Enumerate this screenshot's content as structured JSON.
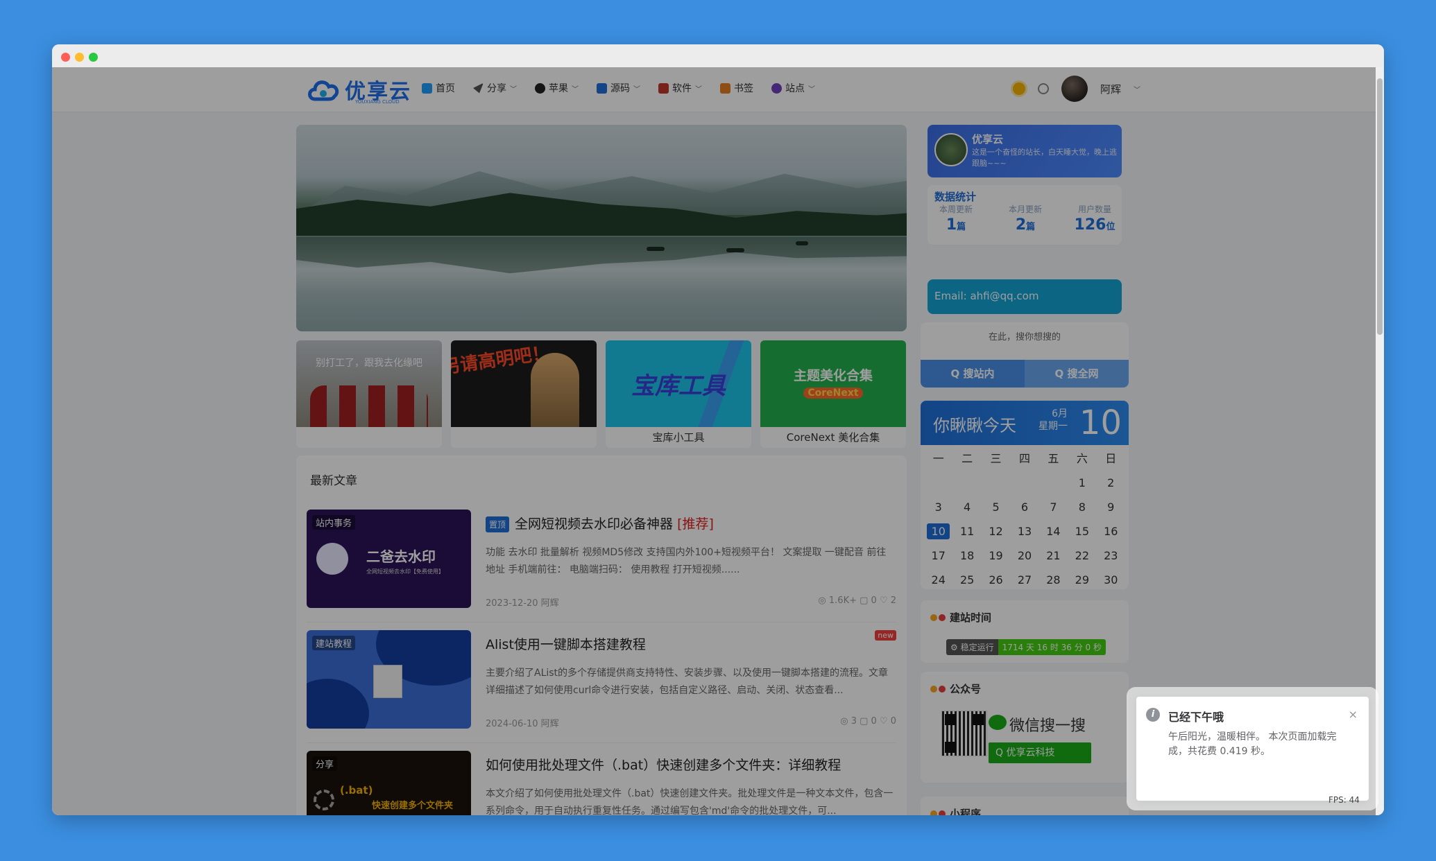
{
  "header": {
    "logo_text": "优享云",
    "logo_sub": "YOUXIANG CLOUD",
    "nav": [
      {
        "label": "首页",
        "color": "#1e9fff",
        "has_chevron": false
      },
      {
        "label": "分享",
        "color": "#555",
        "has_chevron": true
      },
      {
        "label": "苹果",
        "color": "#222",
        "has_chevron": true
      },
      {
        "label": "源码",
        "color": "#1e6fd9",
        "has_chevron": true
      },
      {
        "label": "软件",
        "color": "#c0392b",
        "has_chevron": true
      },
      {
        "label": "书签",
        "color": "#e67e22",
        "has_chevron": false
      },
      {
        "label": "站点",
        "color": "#6f42c1",
        "has_chevron": true
      }
    ],
    "user": "阿辉"
  },
  "promos": [
    {
      "img_text": "别打工了，跟我去化缘吧",
      "caption": ""
    },
    {
      "img_text": "另请高明吧！",
      "caption": ""
    },
    {
      "img_text": "宝库工具",
      "caption": "宝库小工具"
    },
    {
      "img_text": "主题美化合集",
      "img_sub": "CoreNext",
      "caption": "CoreNext 美化合集"
    }
  ],
  "articles": {
    "section_title": "最新文章",
    "items": [
      {
        "tag": "站内事务",
        "thumb_text": "二爸去水印",
        "thumb_sub": "全网短视频去水印【免费使用】",
        "pin": "置顶",
        "title": "全网短视频去水印必备神器",
        "rec": "[推荐]",
        "desc": "功能 去水印 批量解析 视频MD5修改 支持国内外100+短视频平台！ 文案提取 一键配音 前往地址 手机端前往：  电脑端扫码：  使用教程 打开短视频......",
        "meta": "2023-12-20 阿辉",
        "stats": "◎ 1.6K+ ▢ 0 ♡ 2"
      },
      {
        "tag": "建站教程",
        "new": "new",
        "title": "Alist使用一键脚本搭建教程",
        "desc": "主要介绍了AList的多个存储提供商支持特性、安装步骤、以及使用一键脚本搭建的流程。文章详细描述了如何使用curl命令进行安装，包括自定义路径、启动、关闭、状态查看...",
        "meta": "2024-06-10 阿辉",
        "stats": "◎ 3 ▢ 0 ♡ 0"
      },
      {
        "tag": "分享",
        "thumb_text": "(.bat)",
        "thumb_sub": "快速创建多个文件夹",
        "title": "如何使用批处理文件（.bat）快速创建多个文件夹：详细教程",
        "desc": "本文介绍了如何使用批处理文件（.bat）快速创建文件夹。批处理文件是一种文本文件，包含一系列命令，用于自动执行重复性任务。通过编写包含'md'命令的批处理文件，可..."
      }
    ]
  },
  "sidebar": {
    "profile_name": "优享云",
    "profile_desc": "这是一个奋怪的站长，白天睡大觉，晚上逃跟脑~~~",
    "stats_title": "数据统计",
    "stats": [
      {
        "label": "本周更新",
        "value": "1",
        "unit": "篇"
      },
      {
        "label": "本月更新",
        "value": "2",
        "unit": "篇"
      },
      {
        "label": "用户数量",
        "value": "126",
        "unit": "位"
      }
    ],
    "email": "Email:  ahfi@qq.com",
    "search_placeholder": "在此，搜你想搜的",
    "search_site": "Q 搜站内",
    "search_web": "Q 搜全网",
    "cal_text": "你瞅瞅今天",
    "cal_month": "6月",
    "cal_weekday": "星期一",
    "cal_day": "10",
    "weekdays": [
      "一",
      "二",
      "三",
      "四",
      "五",
      "六",
      "日"
    ],
    "days": [
      "",
      "",
      "",
      "",
      "",
      "1",
      "2",
      "3",
      "4",
      "5",
      "6",
      "7",
      "8",
      "9",
      "10",
      "11",
      "12",
      "13",
      "14",
      "15",
      "16",
      "17",
      "18",
      "19",
      "20",
      "21",
      "22",
      "23",
      "24",
      "25",
      "26",
      "27",
      "28",
      "29",
      "30"
    ],
    "today": "10",
    "build_title": "建站时间",
    "run_label": "⚙ 稳定运行",
    "run_value": "1714 天 16 时 36 分 0 秒",
    "wx_title": "公众号",
    "wx_text": "微信搜一搜",
    "wx_btn": "Q 优享云科技",
    "mini_title": "小程序"
  },
  "toast": {
    "title": "已经下午哦",
    "message": "午后阳光，温暖相伴。 本次页面加载完成，共花费 0.419 秒。",
    "close": "×"
  },
  "fps": "FPS: 44"
}
